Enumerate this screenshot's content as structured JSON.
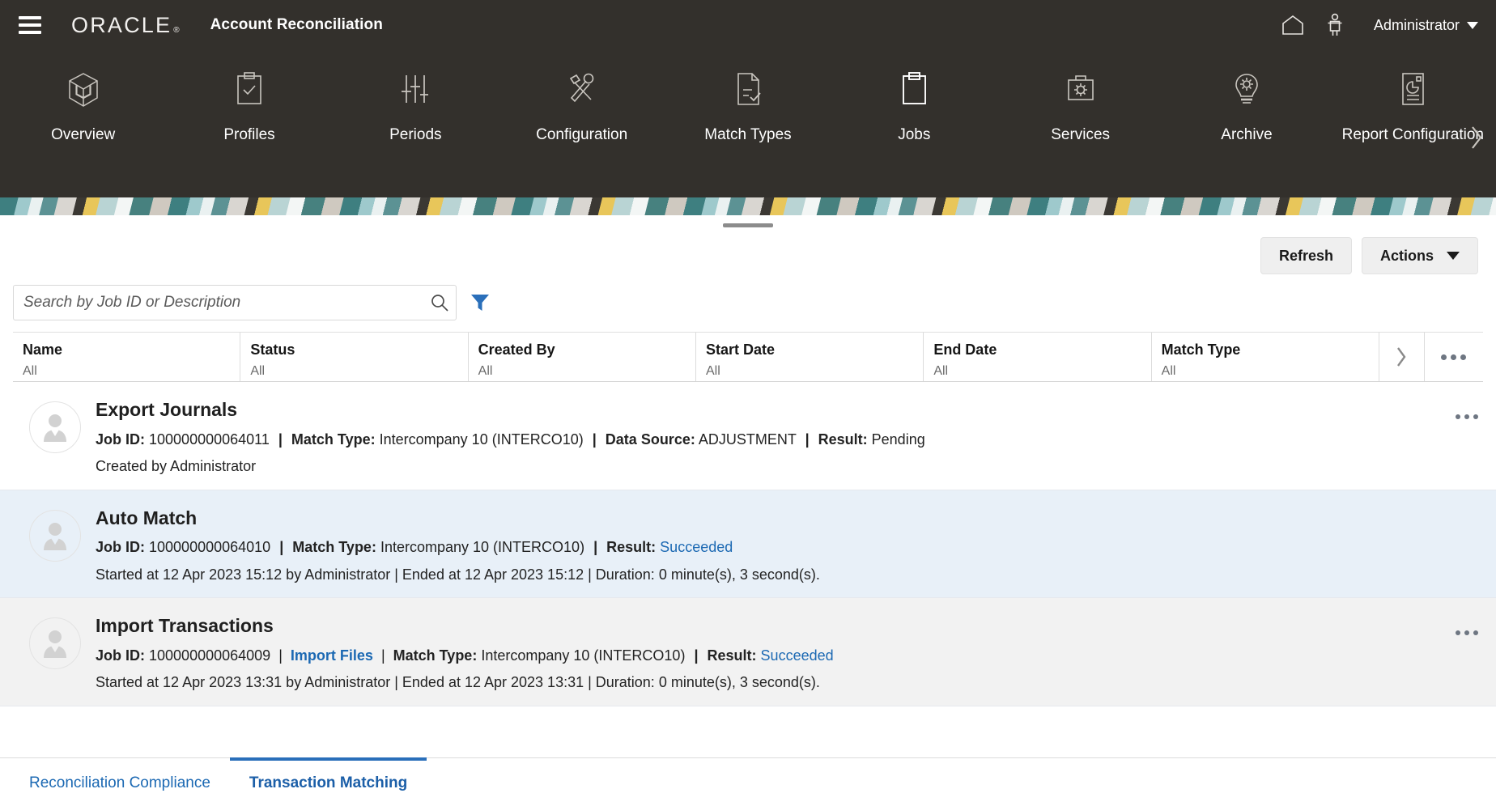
{
  "header": {
    "menu_icon": "hamburger-icon",
    "brand": "ORACLE",
    "brand_reg": "®",
    "app_title": "Account Reconciliation",
    "home_icon": "home-icon",
    "accessibility_icon": "accessibility-person-icon",
    "user_name": "Administrator",
    "user_caret_icon": "chevron-down-icon"
  },
  "nav": {
    "items": [
      {
        "label": "Overview",
        "icon": "cube-icon",
        "active": false
      },
      {
        "label": "Profiles",
        "icon": "clipboard-check-icon",
        "active": false
      },
      {
        "label": "Periods",
        "icon": "sliders-icon",
        "active": false
      },
      {
        "label": "Configuration",
        "icon": "hammer-wrench-icon",
        "active": false
      },
      {
        "label": "Match Types",
        "icon": "document-check-icon",
        "active": false
      },
      {
        "label": "Jobs",
        "icon": "clipboard-icon",
        "active": true
      },
      {
        "label": "Services",
        "icon": "toolbox-gear-icon",
        "active": false
      },
      {
        "label": "Archive",
        "icon": "lightbulb-icon",
        "active": false
      },
      {
        "label": "Report Configuration",
        "icon": "report-piechart-icon",
        "active": false
      }
    ],
    "next_arrow_icon": "chevron-right-icon"
  },
  "toolbar": {
    "refresh_label": "Refresh",
    "actions_label": "Actions",
    "actions_caret_icon": "caret-down-icon"
  },
  "search": {
    "value": "",
    "placeholder": "Search by Job ID or Description",
    "search_icon": "search-icon",
    "filter_icon": "filter-funnel-icon",
    "filter_color": "#2a6fba"
  },
  "table": {
    "columns": [
      {
        "title": "Name",
        "filter": "All"
      },
      {
        "title": "Status",
        "filter": "All"
      },
      {
        "title": "Created By",
        "filter": "All"
      },
      {
        "title": "Start Date",
        "filter": "All"
      },
      {
        "title": "End Date",
        "filter": "All"
      },
      {
        "title": "Match Type",
        "filter": "All"
      }
    ],
    "expand_icon": "chevron-right-icon",
    "column_menu_icon": "overflow-dots-icon"
  },
  "jobs": [
    {
      "title": "Export Journals",
      "avatar_icon": "user-avatar-icon",
      "row_style": "bg-white",
      "show_more": true,
      "more_icon": "overflow-dots-icon",
      "meta": {
        "job_id_label": "Job ID:",
        "job_id": "100000000064011",
        "import_files_link": null,
        "match_type_label": "Match Type:",
        "match_type": "Intercompany 10 (INTERCO10)",
        "data_source_label": "Data Source:",
        "data_source": "ADJUSTMENT",
        "result_label": "Result:",
        "result": "Pending",
        "result_is_link": false
      },
      "sub": "Created by Administrator"
    },
    {
      "title": "Auto Match",
      "avatar_icon": "user-avatar-icon",
      "row_style": "bg-blue",
      "show_more": false,
      "more_icon": "overflow-dots-icon",
      "meta": {
        "job_id_label": "Job ID:",
        "job_id": "100000000064010",
        "import_files_link": null,
        "match_type_label": "Match Type:",
        "match_type": "Intercompany 10 (INTERCO10)",
        "data_source_label": null,
        "data_source": null,
        "result_label": "Result:",
        "result": "Succeeded",
        "result_is_link": true
      },
      "sub": "Started at 12 Apr 2023 15:12 by Administrator  | Ended at 12 Apr 2023 15:12 | Duration: 0 minute(s), 3 second(s)."
    },
    {
      "title": "Import Transactions",
      "avatar_icon": "user-avatar-icon",
      "row_style": "bg-gray",
      "show_more": true,
      "more_icon": "overflow-dots-icon",
      "meta": {
        "job_id_label": "Job ID:",
        "job_id": "100000000064009",
        "import_files_link": "Import Files",
        "match_type_label": "Match Type:",
        "match_type": "Intercompany 10 (INTERCO10)",
        "data_source_label": null,
        "data_source": null,
        "result_label": "Result:",
        "result": "Succeeded",
        "result_is_link": true
      },
      "sub": "Started at 12 Apr 2023 13:31 by Administrator  | Ended at 12 Apr 2023 13:31 | Duration: 0 minute(s), 3 second(s)."
    }
  ],
  "bottom_tabs": [
    {
      "label": "Reconciliation Compliance",
      "active": false
    },
    {
      "label": "Transaction Matching",
      "active": true
    }
  ],
  "colors": {
    "header_bg": "#33302c",
    "accent_blue": "#1c69b3",
    "selected_row": "#e8f0f8",
    "alt_row": "#f2f2f2"
  }
}
